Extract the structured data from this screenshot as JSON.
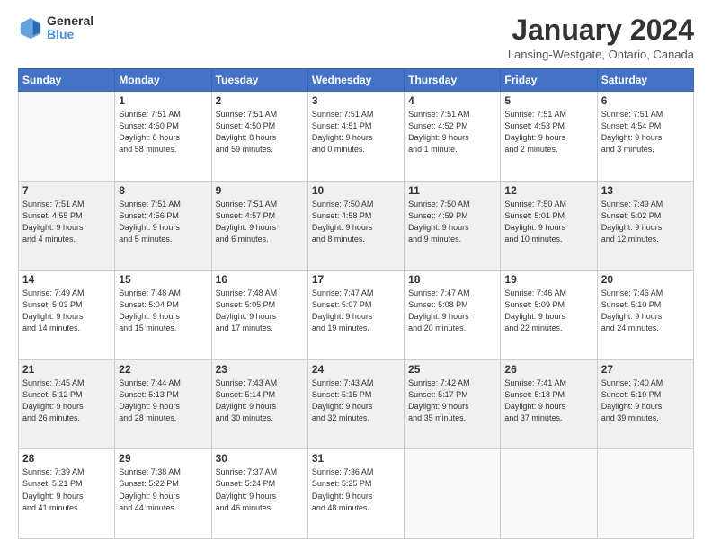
{
  "header": {
    "logo_general": "General",
    "logo_blue": "Blue",
    "main_title": "January 2024",
    "subtitle": "Lansing-Westgate, Ontario, Canada"
  },
  "days_of_week": [
    "Sunday",
    "Monday",
    "Tuesday",
    "Wednesday",
    "Thursday",
    "Friday",
    "Saturday"
  ],
  "weeks": [
    {
      "shade": "white",
      "days": [
        {
          "num": "",
          "info": ""
        },
        {
          "num": "1",
          "info": "Sunrise: 7:51 AM\nSunset: 4:50 PM\nDaylight: 8 hours\nand 58 minutes."
        },
        {
          "num": "2",
          "info": "Sunrise: 7:51 AM\nSunset: 4:50 PM\nDaylight: 8 hours\nand 59 minutes."
        },
        {
          "num": "3",
          "info": "Sunrise: 7:51 AM\nSunset: 4:51 PM\nDaylight: 9 hours\nand 0 minutes."
        },
        {
          "num": "4",
          "info": "Sunrise: 7:51 AM\nSunset: 4:52 PM\nDaylight: 9 hours\nand 1 minute."
        },
        {
          "num": "5",
          "info": "Sunrise: 7:51 AM\nSunset: 4:53 PM\nDaylight: 9 hours\nand 2 minutes."
        },
        {
          "num": "6",
          "info": "Sunrise: 7:51 AM\nSunset: 4:54 PM\nDaylight: 9 hours\nand 3 minutes."
        }
      ]
    },
    {
      "shade": "shaded",
      "days": [
        {
          "num": "7",
          "info": "Sunrise: 7:51 AM\nSunset: 4:55 PM\nDaylight: 9 hours\nand 4 minutes."
        },
        {
          "num": "8",
          "info": "Sunrise: 7:51 AM\nSunset: 4:56 PM\nDaylight: 9 hours\nand 5 minutes."
        },
        {
          "num": "9",
          "info": "Sunrise: 7:51 AM\nSunset: 4:57 PM\nDaylight: 9 hours\nand 6 minutes."
        },
        {
          "num": "10",
          "info": "Sunrise: 7:50 AM\nSunset: 4:58 PM\nDaylight: 9 hours\nand 8 minutes."
        },
        {
          "num": "11",
          "info": "Sunrise: 7:50 AM\nSunset: 4:59 PM\nDaylight: 9 hours\nand 9 minutes."
        },
        {
          "num": "12",
          "info": "Sunrise: 7:50 AM\nSunset: 5:01 PM\nDaylight: 9 hours\nand 10 minutes."
        },
        {
          "num": "13",
          "info": "Sunrise: 7:49 AM\nSunset: 5:02 PM\nDaylight: 9 hours\nand 12 minutes."
        }
      ]
    },
    {
      "shade": "white",
      "days": [
        {
          "num": "14",
          "info": "Sunrise: 7:49 AM\nSunset: 5:03 PM\nDaylight: 9 hours\nand 14 minutes."
        },
        {
          "num": "15",
          "info": "Sunrise: 7:48 AM\nSunset: 5:04 PM\nDaylight: 9 hours\nand 15 minutes."
        },
        {
          "num": "16",
          "info": "Sunrise: 7:48 AM\nSunset: 5:05 PM\nDaylight: 9 hours\nand 17 minutes."
        },
        {
          "num": "17",
          "info": "Sunrise: 7:47 AM\nSunset: 5:07 PM\nDaylight: 9 hours\nand 19 minutes."
        },
        {
          "num": "18",
          "info": "Sunrise: 7:47 AM\nSunset: 5:08 PM\nDaylight: 9 hours\nand 20 minutes."
        },
        {
          "num": "19",
          "info": "Sunrise: 7:46 AM\nSunset: 5:09 PM\nDaylight: 9 hours\nand 22 minutes."
        },
        {
          "num": "20",
          "info": "Sunrise: 7:46 AM\nSunset: 5:10 PM\nDaylight: 9 hours\nand 24 minutes."
        }
      ]
    },
    {
      "shade": "shaded",
      "days": [
        {
          "num": "21",
          "info": "Sunrise: 7:45 AM\nSunset: 5:12 PM\nDaylight: 9 hours\nand 26 minutes."
        },
        {
          "num": "22",
          "info": "Sunrise: 7:44 AM\nSunset: 5:13 PM\nDaylight: 9 hours\nand 28 minutes."
        },
        {
          "num": "23",
          "info": "Sunrise: 7:43 AM\nSunset: 5:14 PM\nDaylight: 9 hours\nand 30 minutes."
        },
        {
          "num": "24",
          "info": "Sunrise: 7:43 AM\nSunset: 5:15 PM\nDaylight: 9 hours\nand 32 minutes."
        },
        {
          "num": "25",
          "info": "Sunrise: 7:42 AM\nSunset: 5:17 PM\nDaylight: 9 hours\nand 35 minutes."
        },
        {
          "num": "26",
          "info": "Sunrise: 7:41 AM\nSunset: 5:18 PM\nDaylight: 9 hours\nand 37 minutes."
        },
        {
          "num": "27",
          "info": "Sunrise: 7:40 AM\nSunset: 5:19 PM\nDaylight: 9 hours\nand 39 minutes."
        }
      ]
    },
    {
      "shade": "white",
      "days": [
        {
          "num": "28",
          "info": "Sunrise: 7:39 AM\nSunset: 5:21 PM\nDaylight: 9 hours\nand 41 minutes."
        },
        {
          "num": "29",
          "info": "Sunrise: 7:38 AM\nSunset: 5:22 PM\nDaylight: 9 hours\nand 44 minutes."
        },
        {
          "num": "30",
          "info": "Sunrise: 7:37 AM\nSunset: 5:24 PM\nDaylight: 9 hours\nand 46 minutes."
        },
        {
          "num": "31",
          "info": "Sunrise: 7:36 AM\nSunset: 5:25 PM\nDaylight: 9 hours\nand 48 minutes."
        },
        {
          "num": "",
          "info": ""
        },
        {
          "num": "",
          "info": ""
        },
        {
          "num": "",
          "info": ""
        }
      ]
    }
  ]
}
